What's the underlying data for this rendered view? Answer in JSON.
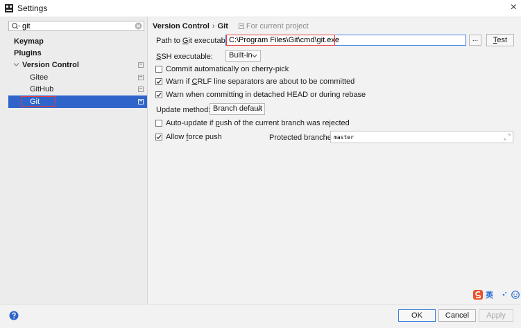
{
  "window": {
    "title": "Settings",
    "close_glyph": "×"
  },
  "sidebar": {
    "search_value": "git",
    "items": [
      {
        "label": "Keymap"
      },
      {
        "label": "Plugins"
      },
      {
        "label": "Version Control"
      },
      {
        "label": "Gitee"
      },
      {
        "label": "GitHub"
      },
      {
        "label": "Git"
      }
    ]
  },
  "breadcrumb": {
    "parent": "Version Control",
    "separator": "›",
    "current": "Git",
    "scope": "For current project"
  },
  "form": {
    "path_label_pre": "Path to ",
    "path_label_u": "G",
    "path_label_post": "it executable:",
    "path_value": "C:\\Program Files\\Git\\cmd\\git.exe",
    "browse_label": "...",
    "test_u": "T",
    "test_rest": "est",
    "ssh_u": "S",
    "ssh_rest": "SH executable:",
    "ssh_value": "Built-in",
    "opt_cherry": "Commit automatically on cherry-pick",
    "opt_crlf_pre": "Warn if ",
    "opt_crlf_u": "C",
    "opt_crlf_post": "RLF line separators are about to be committed",
    "opt_detached": "Warn when committing in detached HEAD or during rebase",
    "update_label": "Update method:",
    "update_value": "Branch default",
    "opt_autoupdate_pre": "Auto-update if ",
    "opt_autoupdate_u": "p",
    "opt_autoupdate_post": "ush of the current branch was rejected",
    "opt_force_pre": "Allow ",
    "opt_force_u": "f",
    "opt_force_post": "orce push",
    "protected_label": "Protected branches:",
    "protected_value": "master",
    "checks": {
      "cherry": false,
      "crlf": true,
      "detached": true,
      "autoupdate": false,
      "force": true
    }
  },
  "footer": {
    "ok": "OK",
    "cancel": "Cancel",
    "apply": "Apply"
  },
  "ime": {
    "label": "英"
  },
  "colors": {
    "selection": "#2f65ca",
    "highlight_outline": "#e83a3a",
    "focus_border": "#3b7de0"
  }
}
